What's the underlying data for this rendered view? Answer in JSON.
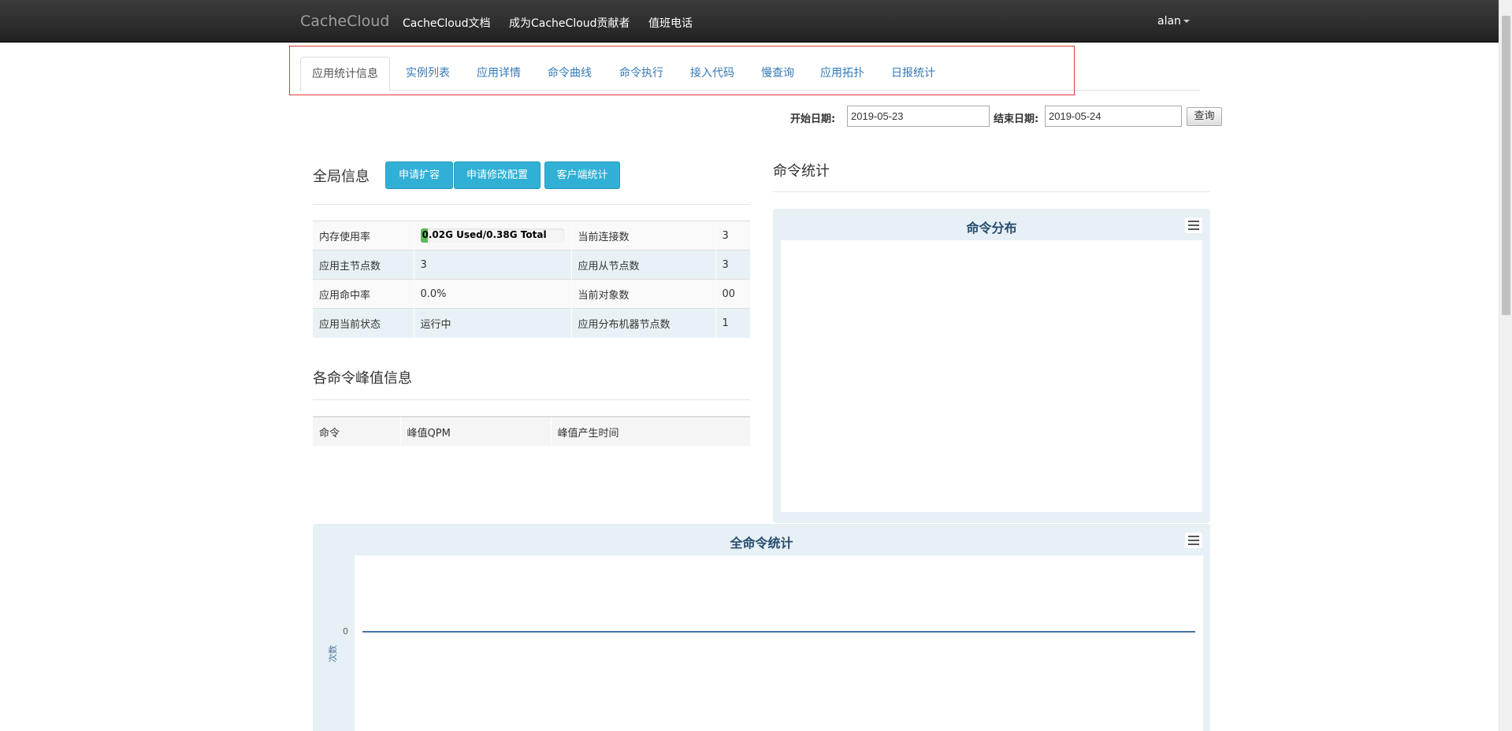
{
  "navbar": {
    "brand": "CacheCloud",
    "links": [
      "CacheCloud文档",
      "成为CacheCloud贡献者",
      "值班电话"
    ],
    "user": "alan"
  },
  "tabs": [
    "应用统计信息",
    "实例列表",
    "应用详情",
    "命令曲线",
    "命令执行",
    "接入代码",
    "慢查询",
    "应用拓扑",
    "日报统计"
  ],
  "date_filter": {
    "start_label": "开始日期:",
    "start_value": "2019-05-23",
    "end_label": "结束日期:",
    "end_value": "2019-05-24",
    "query_label": "查询"
  },
  "global_info": {
    "title": "全局信息",
    "buttons": [
      "申请扩容",
      "申请修改配置",
      "客户端统计"
    ],
    "memory_label": "内存使用率",
    "memory_text": "0.02G  Used/0.38G  Total",
    "memory_fraction": 0.0526,
    "rows": [
      [
        "应用主节点数",
        "3",
        "应用从节点数",
        "3"
      ],
      [
        "应用命中率",
        "0.0%",
        "当前对象数",
        "00"
      ],
      [
        "应用当前状态",
        "运行中",
        "应用分布机器节点数",
        "1"
      ]
    ],
    "connections_label": "当前连接数",
    "connections_value": "3"
  },
  "peak_info": {
    "title": "各命令峰值信息",
    "headers": [
      "命令",
      "峰值QPM",
      "峰值产生时间"
    ]
  },
  "command_stats": {
    "title": "命令统计",
    "pie_title": "命令分布"
  },
  "all_commands_chart": {
    "title": "全命令统计",
    "y_axis_title": "次数",
    "y_tick": "0"
  },
  "chart_data": [
    {
      "type": "pie",
      "title": "命令分布",
      "categories": [],
      "values": []
    },
    {
      "type": "line",
      "title": "全命令统计",
      "ylabel": "次数",
      "x": [],
      "series": [
        {
          "values": [
            0
          ]
        }
      ],
      "yticks": [
        0
      ]
    }
  ]
}
